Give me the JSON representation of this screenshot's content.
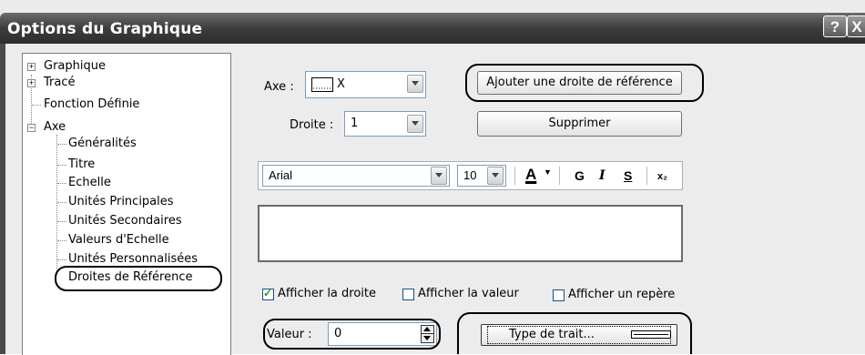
{
  "window": {
    "title": "Options du Graphique",
    "help_glyph": "?",
    "close_glyph": "X"
  },
  "tree": {
    "items": [
      {
        "label": "Graphique",
        "expander": "+"
      },
      {
        "label": "Tracé",
        "expander": "+"
      },
      {
        "label": "Fonction Définie"
      },
      {
        "label": "Axe",
        "expander": "−"
      },
      {
        "label": "Généralités"
      },
      {
        "label": "Titre"
      },
      {
        "label": "Echelle"
      },
      {
        "label": "Unités Principales"
      },
      {
        "label": "Unités Secondaires"
      },
      {
        "label": "Valeurs d'Echelle"
      },
      {
        "label": "Unités Personnalisées"
      },
      {
        "label": "Droites de Référence",
        "selected": true
      }
    ]
  },
  "form": {
    "axe_label": "Axe :",
    "axe_value": "X",
    "droite_label": "Droite :",
    "droite_value": "1",
    "add_ref_button": "Ajouter une droite de référence",
    "delete_button": "Supprimer",
    "font_name": "Arial",
    "font_size": "10",
    "font_color_glyph": "A",
    "bold_glyph": "G",
    "italic_glyph": "I",
    "underline_glyph": "S",
    "subscript_glyph": "x₂",
    "text_area_value": "",
    "show_line_label": "Afficher la droite",
    "show_line_checked": true,
    "show_value_label": "Afficher la valeur",
    "show_value_checked": false,
    "show_marker_label": "Afficher un repère",
    "show_marker_checked": false,
    "valeur_label": "Valeur :",
    "valeur_value": "0",
    "line_type_button": "Type de trait..."
  }
}
